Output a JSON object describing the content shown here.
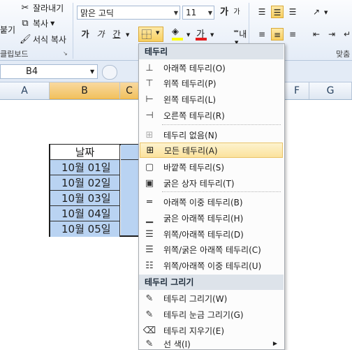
{
  "ribbon": {
    "cut_label": "잘라내기",
    "copy_label": "복사",
    "format_painter_label": "서식 복사",
    "paste_label": "붙기",
    "clipboard_label": "클립보드",
    "font_name": "맑은 고딕",
    "font_size": "11",
    "grow_font": "가",
    "shrink_font": "가",
    "bold": "가",
    "italic": "가",
    "underline": "간",
    "font_color_glyph": "가",
    "phonetic_glyph": "내",
    "align_group_label": "맞춤"
  },
  "namebox": {
    "value": "B4"
  },
  "columns": [
    "A",
    "B",
    "C",
    "F",
    "G"
  ],
  "table": {
    "header": "날짜",
    "rows": [
      "10월 01일",
      "10월 02일",
      "10월 03일",
      "10월 04일",
      "10월 05일"
    ]
  },
  "menu": {
    "section1": "테두리",
    "items1": [
      "아래쪽 테두리(O)",
      "위쪽 테두리(P)",
      "왼쪽 테두리(L)",
      "오른쪽 테두리(R)"
    ],
    "items2": [
      "테두리 없음(N)",
      "모든 테두리(A)",
      "바깥쪽 테두리(S)",
      "굵은 상자 테두리(T)"
    ],
    "items3": [
      "아래쪽 이중 테두리(B)",
      "굵은 아래쪽 테두리(H)",
      "위쪽/아래쪽 테두리(D)",
      "위쪽/굵은 아래쪽 테두리(C)",
      "위쪽/아래쪽 이중 테두리(U)"
    ],
    "section2": "테두리 그리기",
    "items4": [
      "테두리 그리기(W)",
      "테두리 눈금 그리기(G)",
      "테두리 지우기(E)",
      "선 색(I)"
    ]
  },
  "colors": {
    "font_color": "#e31c1c",
    "fill_color": "#ffff00",
    "selection": "#b9d3f2",
    "hot_item": "#fbe29c"
  }
}
